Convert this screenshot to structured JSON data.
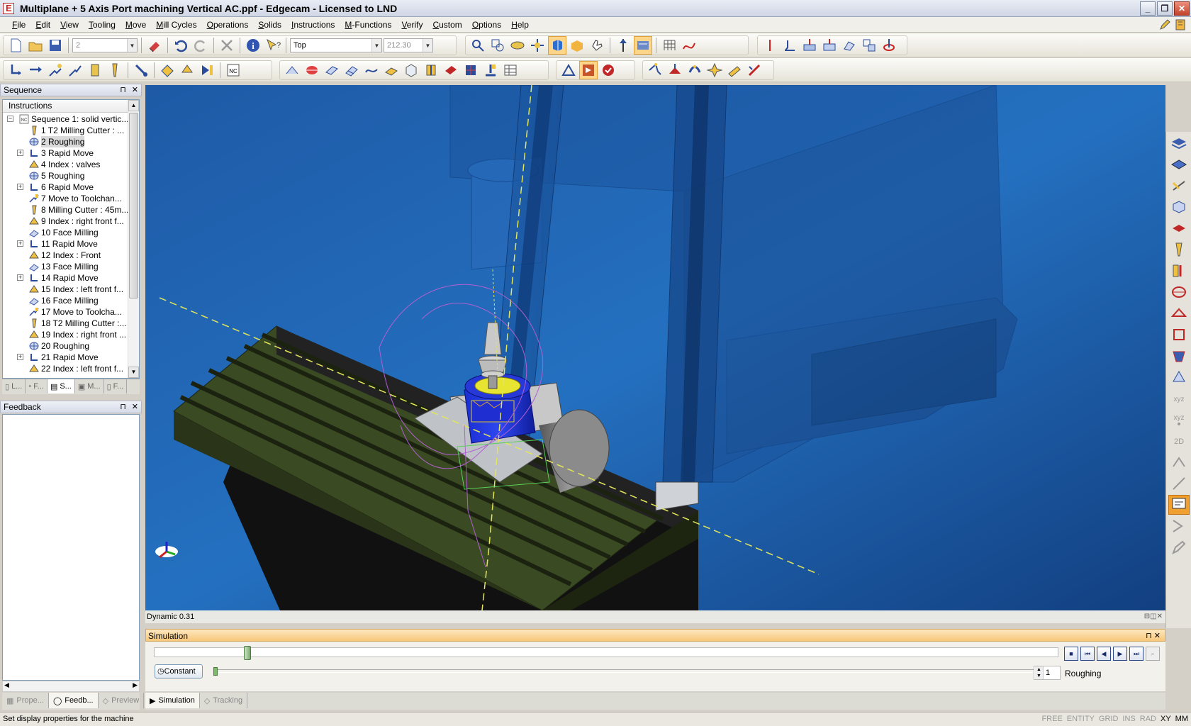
{
  "window": {
    "title": "Multiplane + 5 Axis Port machining Vertical AC.ppf - Edgecam - Licensed to LND",
    "min": "_",
    "max": "❐",
    "close": "✕"
  },
  "menu": [
    "File",
    "Edit",
    "View",
    "Tooling",
    "Move",
    "Mill Cycles",
    "Operations",
    "Solids",
    "Instructions",
    "M-Functions",
    "Verify",
    "Custom",
    "Options",
    "Help"
  ],
  "toolbar": {
    "layer_combo": "2",
    "view_combo": "Top",
    "depth_combo": "212.30"
  },
  "sequence_panel": {
    "title": "Sequence",
    "instructions_header": "Instructions",
    "pin": "⊓",
    "close": "✕",
    "items": [
      {
        "label": "Sequence 1: solid vertic...",
        "icon": "nc-icon",
        "expander": "−",
        "indent": 0
      },
      {
        "label": "1 T2 Milling Cutter : ...",
        "icon": "milling-cutter-icon",
        "expander": "",
        "indent": 1
      },
      {
        "label": "2 Roughing",
        "icon": "roughing-icon",
        "expander": "",
        "indent": 1,
        "selected": true
      },
      {
        "label": "3 Rapid Move",
        "icon": "rapid-move-icon",
        "expander": "+",
        "indent": 1
      },
      {
        "label": "4 Index : valves",
        "icon": "index-icon",
        "expander": "",
        "indent": 1
      },
      {
        "label": "5 Roughing",
        "icon": "roughing-icon",
        "expander": "",
        "indent": 1
      },
      {
        "label": "6 Rapid Move",
        "icon": "rapid-move-icon",
        "expander": "+",
        "indent": 1
      },
      {
        "label": "7 Move to Toolchan...",
        "icon": "toolchange-icon",
        "expander": "",
        "indent": 1
      },
      {
        "label": "8 Milling Cutter : 45m...",
        "icon": "milling-cutter-icon",
        "expander": "",
        "indent": 1
      },
      {
        "label": "9 Index : right front f...",
        "icon": "index-icon",
        "expander": "",
        "indent": 1
      },
      {
        "label": "10 Face Milling",
        "icon": "face-milling-icon",
        "expander": "",
        "indent": 1
      },
      {
        "label": "11 Rapid Move",
        "icon": "rapid-move-icon",
        "expander": "+",
        "indent": 1
      },
      {
        "label": "12 Index : Front",
        "icon": "index-icon",
        "expander": "",
        "indent": 1
      },
      {
        "label": "13 Face Milling",
        "icon": "face-milling-icon",
        "expander": "",
        "indent": 1
      },
      {
        "label": "14 Rapid Move",
        "icon": "rapid-move-icon",
        "expander": "+",
        "indent": 1
      },
      {
        "label": "15 Index : left front f...",
        "icon": "index-icon",
        "expander": "",
        "indent": 1
      },
      {
        "label": "16 Face Milling",
        "icon": "face-milling-icon",
        "expander": "",
        "indent": 1
      },
      {
        "label": "17 Move to Toolcha...",
        "icon": "toolchange-icon",
        "expander": "",
        "indent": 1
      },
      {
        "label": "18 T2 Milling Cutter :...",
        "icon": "milling-cutter-icon",
        "expander": "",
        "indent": 1
      },
      {
        "label": "19 Index : right front ...",
        "icon": "index-icon",
        "expander": "",
        "indent": 1
      },
      {
        "label": "20 Roughing",
        "icon": "roughing-icon",
        "expander": "",
        "indent": 1
      },
      {
        "label": "21 Rapid Move",
        "icon": "rapid-move-icon",
        "expander": "+",
        "indent": 1
      },
      {
        "label": "22 Index : left front f...",
        "icon": "index-icon",
        "expander": "",
        "indent": 1
      }
    ],
    "tabs": [
      "L...",
      "F...",
      "S...",
      "M...",
      "F..."
    ]
  },
  "feedback_panel": {
    "title": "Feedback"
  },
  "viewport": {
    "status": "Dynamic 0.31"
  },
  "simulation": {
    "title": "Simulation",
    "constant_label": "Constant",
    "step_value": "1",
    "operation": "Roughing",
    "progress": 0.1,
    "speed": 0.0
  },
  "bottom_tabs_left": [
    "Prope...",
    "Feedb...",
    "Preview"
  ],
  "bottom_tabs_right": [
    "Simulation",
    "Tracking"
  ],
  "status": {
    "message": "Set display properties for the machine",
    "flags": [
      "FREE",
      "ENTITY",
      "GRID",
      "INS",
      "RAD",
      "XY",
      "MM"
    ]
  },
  "colors": {
    "viewport_bg": "#1f6ab5",
    "table_green": "#37471f",
    "stock_blue": "#1a2fb5",
    "title_bar": "#dfe4ee",
    "sim_header": "#f8c77a"
  }
}
